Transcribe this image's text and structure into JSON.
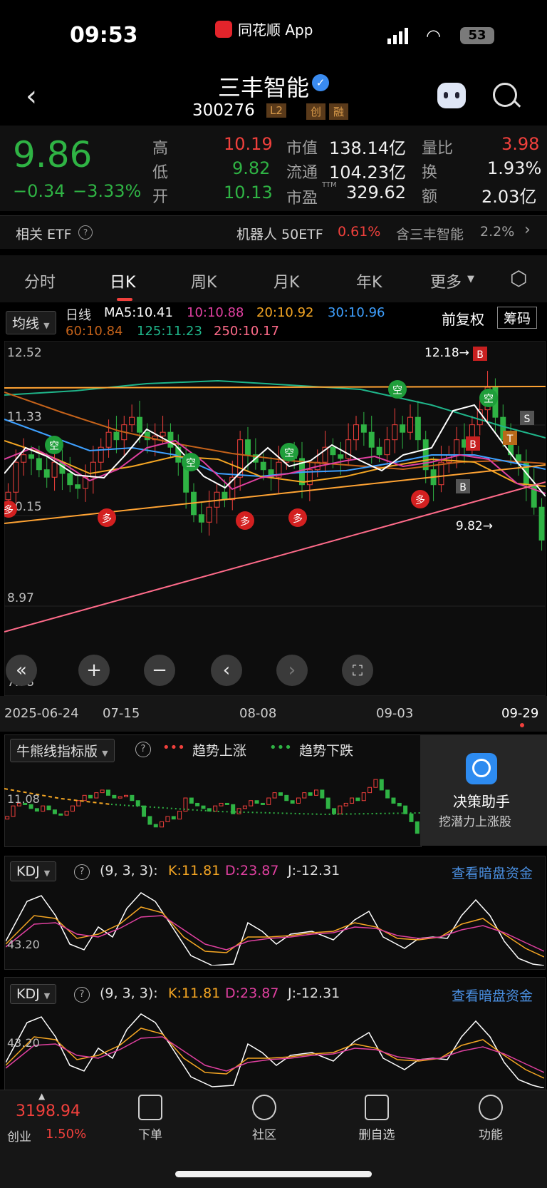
{
  "status_bar": {
    "time": "09:53",
    "app_name": "同花顺 App",
    "battery": "53"
  },
  "header": {
    "stock_name": "三丰智能",
    "stock_code": "300276",
    "badges": [
      "L2",
      "创",
      "融"
    ]
  },
  "quote": {
    "price": "9.86",
    "change": "−0.34",
    "change_pct": "−3.33%",
    "high_label": "高",
    "high": "10.19",
    "low_label": "低",
    "low": "9.82",
    "open_label": "开",
    "open": "10.13",
    "mcap_label": "市值",
    "mcap": "138.14亿",
    "float_label": "流通",
    "float": "104.23亿",
    "pe_label": "市盈",
    "pe_sup": "TTM",
    "pe": "329.62",
    "vol_ratio_label": "量比",
    "vol_ratio": "3.98",
    "turnover_label": "换",
    "turnover": "1.93%",
    "amount_label": "额",
    "amount": "2.03亿"
  },
  "etf": {
    "label": "相关 ETF",
    "name": "机器人 50ETF",
    "change": "0.61%",
    "contains": "含三丰智能",
    "weight": "2.2%"
  },
  "tabs": [
    "分时",
    "日K",
    "周K",
    "月K",
    "年K",
    "更多"
  ],
  "ma_legend": {
    "type_select": "均线",
    "period": "日线",
    "ma5": "MA5:10.41",
    "ma10": "10:10.88",
    "ma20": "20:10.92",
    "ma30": "30:10.96",
    "ma60": "60:10.84",
    "ma125": "125:11.23",
    "ma250": "250:10.17",
    "adjust": "前复权",
    "chips": "筹码"
  },
  "price_axis": [
    "12.52",
    "11.33",
    "10.15",
    "8.97",
    "7.78"
  ],
  "chart_annotations": {
    "max_label": "12.18→",
    "min_label": "9.82→"
  },
  "date_axis": [
    "2025-06-24",
    "07-15",
    "08-08",
    "09-03",
    "09-29"
  ],
  "bull_bear": {
    "select": "牛熊线指标版",
    "up_label": "趋势上涨",
    "down_label": "趋势下跌",
    "level": "11.08",
    "assistant_title": "决策助手",
    "assistant_sub": "挖潜力上涨股"
  },
  "kdj_panels": [
    {
      "select": "KDJ",
      "params": "(9, 3, 3):",
      "k": "K:11.81",
      "d": "D:23.87",
      "j": "J:-12.31",
      "link": "查看暗盘资金",
      "level": "43.20"
    },
    {
      "select": "KDJ",
      "params": "(9, 3, 3):",
      "k": "K:11.81",
      "d": "D:23.87",
      "j": "J:-12.31",
      "link": "查看暗盘资金",
      "level": "43.20"
    }
  ],
  "bottom_nav": {
    "index_value": "3198.94",
    "index_name": "创业",
    "index_change": "1.50%",
    "items": [
      "下单",
      "社区",
      "删自选",
      "功能"
    ]
  },
  "colors": {
    "up": "#f0403c",
    "down": "#2fb344",
    "ma5": "#ffffff",
    "ma10": "#e040a0",
    "ma20": "#f5a623",
    "ma30": "#3ea0ff"
  },
  "chart_data": {
    "type": "candlestick",
    "ylim": [
      7.78,
      12.52
    ],
    "x_ticks": [
      "2025-06-24",
      "07-15",
      "08-08",
      "09-03",
      "09-29"
    ],
    "y_ticks": [
      12.52,
      11.33,
      10.15,
      8.97,
      7.78
    ],
    "candles_close": [
      10.5,
      10.9,
      11.0,
      10.95,
      10.8,
      10.7,
      10.9,
      10.75,
      10.6,
      10.55,
      10.7,
      10.9,
      11.1,
      11.3,
      11.2,
      11.4,
      11.5,
      11.3,
      11.2,
      11.25,
      11.3,
      11.1,
      10.9,
      10.5,
      10.2,
      10.1,
      10.3,
      10.5,
      10.4,
      10.7,
      11.2,
      11.0,
      10.9,
      10.8,
      10.7,
      10.9,
      11.0,
      10.95,
      10.6,
      10.8,
      10.9,
      11.1,
      11.0,
      10.95,
      11.2,
      11.4,
      11.3,
      11.1,
      11.0,
      11.2,
      11.4,
      11.3,
      11.5,
      11.2,
      10.8,
      10.6,
      10.9,
      11.0,
      11.2,
      11.1,
      11.4,
      11.6,
      11.9,
      11.5,
      11.2,
      11.0,
      10.9,
      10.6,
      10.3,
      9.86
    ],
    "high": 12.18,
    "low": 9.82
  }
}
